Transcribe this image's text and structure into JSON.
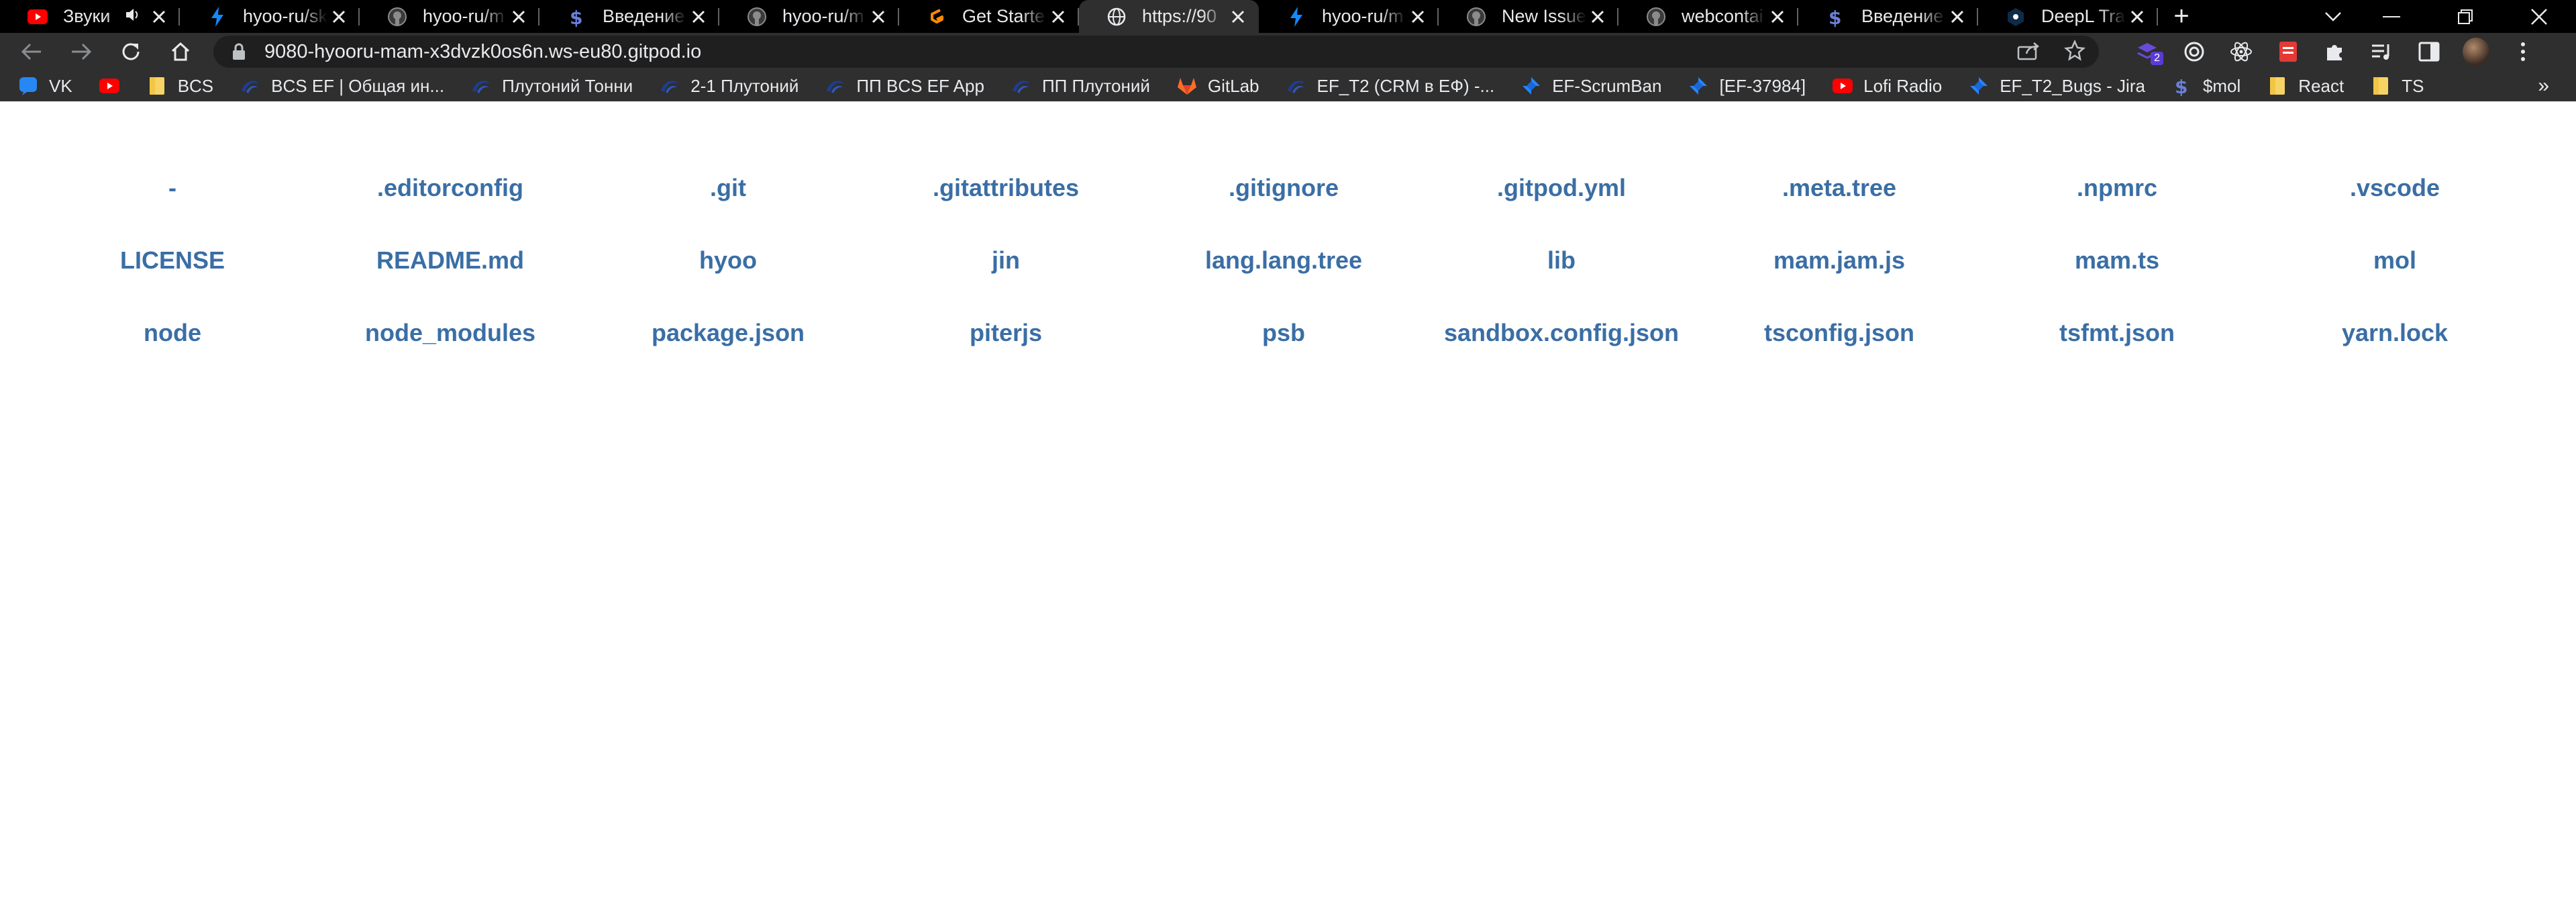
{
  "tabs": [
    {
      "title": "Звуки",
      "icon": "youtube-icon",
      "speaker": true
    },
    {
      "title": "hyoo-ru/sk",
      "icon": "stackblitz-icon"
    },
    {
      "title": "hyoo-ru/m",
      "icon": "github-icon"
    },
    {
      "title": "Введение",
      "icon": "mol-icon"
    },
    {
      "title": "hyoo-ru/m",
      "icon": "github-icon"
    },
    {
      "title": "Get Starte",
      "icon": "gitpod-icon"
    },
    {
      "title": "https://90",
      "icon": "globe-icon",
      "active": true
    },
    {
      "title": "hyoo-ru/m",
      "icon": "stackblitz-icon"
    },
    {
      "title": "New Issue",
      "icon": "github-icon"
    },
    {
      "title": "webcontai",
      "icon": "github-icon"
    },
    {
      "title": "Введение",
      "icon": "mol-icon"
    },
    {
      "title": "DeepL Tra",
      "icon": "deepl-icon"
    }
  ],
  "address_bar": {
    "url": "9080-hyooru-mam-x3dvzk0os6n.ws-eu80.gitpod.io"
  },
  "extensions": {
    "badge_count": "2"
  },
  "bookmarks": [
    {
      "label": "VK",
      "icon": "vk-icon"
    },
    {
      "label": "",
      "icon": "youtube-icon"
    },
    {
      "label": "BCS",
      "icon": "folder-icon"
    },
    {
      "label": "BCS EF | Общая ин...",
      "icon": "bcs-icon"
    },
    {
      "label": "Плутоний Тонни",
      "icon": "bcs-icon"
    },
    {
      "label": "2-1 Плутоний",
      "icon": "bcs-icon"
    },
    {
      "label": "ПП BCS EF App",
      "icon": "bcs-icon"
    },
    {
      "label": "ПП Плутоний",
      "icon": "bcs-icon"
    },
    {
      "label": "GitLab",
      "icon": "gitlab-icon"
    },
    {
      "label": "EF_T2 (CRM в ЕФ) -...",
      "icon": "bcs-icon"
    },
    {
      "label": "EF-ScrumBan",
      "icon": "jira-icon"
    },
    {
      "label": "[EF-37984]",
      "icon": "jira-icon"
    },
    {
      "label": "Lofi Radio",
      "icon": "youtube-icon"
    },
    {
      "label": "EF_T2_Bugs - Jira",
      "icon": "jira-icon"
    },
    {
      "label": "$mol",
      "icon": "mol-icon"
    },
    {
      "label": "React",
      "icon": "folder-icon"
    },
    {
      "label": "TS",
      "icon": "folder-icon"
    }
  ],
  "files": [
    "-",
    ".editorconfig",
    ".git",
    ".gitattributes",
    ".gitignore",
    ".gitpod.yml",
    ".meta.tree",
    ".npmrc",
    ".vscode",
    "LICENSE",
    "README.md",
    "hyoo",
    "jin",
    "lang.lang.tree",
    "lib",
    "mam.jam.js",
    "mam.ts",
    "mol",
    "node",
    "node_modules",
    "package.json",
    "piterjs",
    "psb",
    "sandbox.config.json",
    "tsconfig.json",
    "tsfmt.json",
    "yarn.lock"
  ],
  "colors": {
    "link": "#3a6ea5",
    "chrome_dark": "#2f2f2f",
    "tabstrip": "#000000"
  }
}
